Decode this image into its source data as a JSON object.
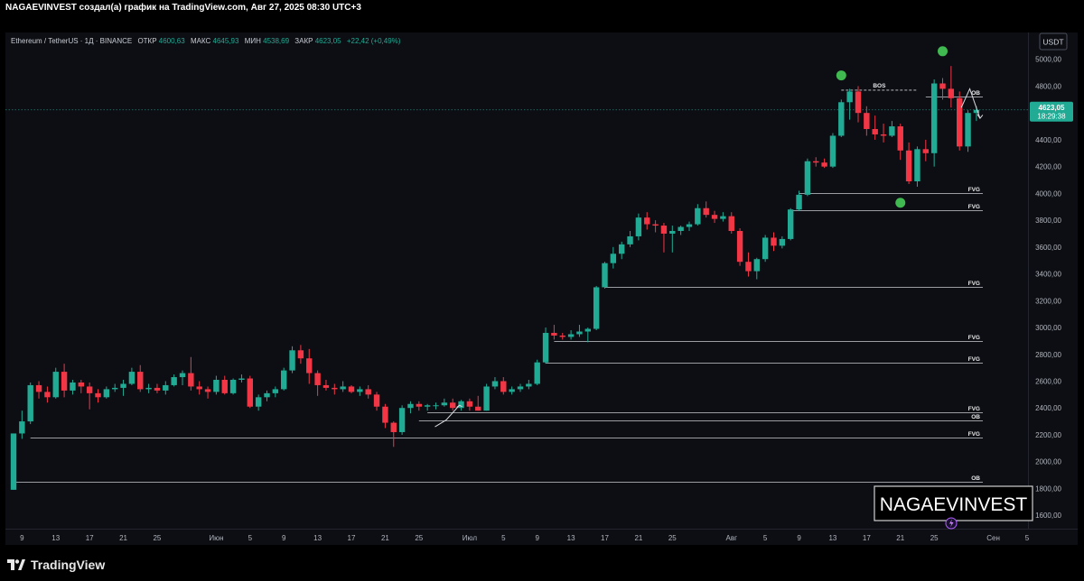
{
  "header": {
    "caption": "NAGAEVINVEST создал(а) график на TradingView.com, Авг 27, 2025 08:30 UTC+3"
  },
  "legend": {
    "symbol": "Ethereum / TetherUS · 1Д · BINANCE",
    "open_label": "ОТКР",
    "open_value": "4600,63",
    "high_label": "МАКС",
    "high_value": "4645,93",
    "low_label": "МИН",
    "low_value": "4538,69",
    "close_label": "ЗАКР",
    "close_value": "4623,05",
    "change": "+22,42 (+0,49%)"
  },
  "currency_button": "USDT",
  "price_badge": {
    "price": "4623,05",
    "countdown": "18:29:38"
  },
  "watermark": "NAGAEVINVEST",
  "brand": "TradingView",
  "colors": {
    "up": "#22ab94",
    "down": "#f23645",
    "background": "#0c0e14",
    "level_line": "#c9ccd3",
    "marker": "#3fb950"
  },
  "chart_data": {
    "type": "candlestick",
    "title": "",
    "ylabel": "",
    "xlabel": "",
    "ylim": [
      1500,
      5200
    ],
    "y_ticks": [
      "1600,00",
      "1800,00",
      "2000,00",
      "2200,00",
      "2400,00",
      "2600,00",
      "2800,00",
      "3000,00",
      "3200,00",
      "3400,00",
      "3600,00",
      "3800,00",
      "4000,00",
      "4200,00",
      "4400,00",
      "4600,00",
      "4800,00",
      "5000,00"
    ],
    "x_tick_labels": [
      {
        "label": "9",
        "bar": 1
      },
      {
        "label": "13",
        "bar": 5
      },
      {
        "label": "17",
        "bar": 9
      },
      {
        "label": "21",
        "bar": 13
      },
      {
        "label": "25",
        "bar": 17
      },
      {
        "label": "Июн",
        "bar": 24
      },
      {
        "label": "5",
        "bar": 28
      },
      {
        "label": "9",
        "bar": 32
      },
      {
        "label": "13",
        "bar": 36
      },
      {
        "label": "17",
        "bar": 40
      },
      {
        "label": "21",
        "bar": 44
      },
      {
        "label": "25",
        "bar": 48
      },
      {
        "label": "Июл",
        "bar": 54
      },
      {
        "label": "5",
        "bar": 58
      },
      {
        "label": "9",
        "bar": 62
      },
      {
        "label": "13",
        "bar": 66
      },
      {
        "label": "17",
        "bar": 70
      },
      {
        "label": "21",
        "bar": 74
      },
      {
        "label": "25",
        "bar": 78
      },
      {
        "label": "Авг",
        "bar": 85
      },
      {
        "label": "5",
        "bar": 89
      },
      {
        "label": "9",
        "bar": 93
      },
      {
        "label": "13",
        "bar": 97
      },
      {
        "label": "17",
        "bar": 101
      },
      {
        "label": "21",
        "bar": 105
      },
      {
        "label": "25",
        "bar": 109
      },
      {
        "label": "Сен",
        "bar": 116
      },
      {
        "label": "5",
        "bar": 120
      }
    ],
    "last_price": 4623.05,
    "candles": [
      [
        1790,
        2210,
        1790,
        2210
      ],
      [
        2210,
        2380,
        2170,
        2300
      ],
      [
        2300,
        2590,
        2280,
        2570
      ],
      [
        2570,
        2600,
        2470,
        2520
      ],
      [
        2520,
        2560,
        2440,
        2480
      ],
      [
        2480,
        2700,
        2470,
        2670
      ],
      [
        2670,
        2730,
        2480,
        2530
      ],
      [
        2530,
        2610,
        2500,
        2590
      ],
      [
        2590,
        2610,
        2510,
        2560
      ],
      [
        2560,
        2590,
        2390,
        2510
      ],
      [
        2510,
        2540,
        2440,
        2480
      ],
      [
        2480,
        2560,
        2470,
        2540
      ],
      [
        2540,
        2580,
        2520,
        2550
      ],
      [
        2550,
        2610,
        2490,
        2580
      ],
      [
        2580,
        2700,
        2570,
        2670
      ],
      [
        2670,
        2720,
        2520,
        2540
      ],
      [
        2540,
        2580,
        2510,
        2550
      ],
      [
        2550,
        2580,
        2510,
        2530
      ],
      [
        2530,
        2600,
        2500,
        2570
      ],
      [
        2570,
        2650,
        2560,
        2630
      ],
      [
        2630,
        2680,
        2570,
        2660
      ],
      [
        2660,
        2780,
        2530,
        2560
      ],
      [
        2560,
        2600,
        2500,
        2540
      ],
      [
        2540,
        2560,
        2470,
        2520
      ],
      [
        2520,
        2640,
        2500,
        2610
      ],
      [
        2610,
        2640,
        2500,
        2510
      ],
      [
        2510,
        2620,
        2500,
        2610
      ],
      [
        2610,
        2650,
        2590,
        2620
      ],
      [
        2620,
        2640,
        2400,
        2410
      ],
      [
        2410,
        2500,
        2380,
        2480
      ],
      [
        2480,
        2530,
        2450,
        2510
      ],
      [
        2510,
        2560,
        2480,
        2540
      ],
      [
        2540,
        2700,
        2530,
        2680
      ],
      [
        2680,
        2860,
        2660,
        2830
      ],
      [
        2830,
        2870,
        2730,
        2770
      ],
      [
        2770,
        2840,
        2580,
        2660
      ],
      [
        2660,
        2680,
        2490,
        2570
      ],
      [
        2570,
        2610,
        2530,
        2550
      ],
      [
        2550,
        2580,
        2500,
        2540
      ],
      [
        2540,
        2600,
        2520,
        2560
      ],
      [
        2560,
        2570,
        2510,
        2520
      ],
      [
        2520,
        2560,
        2490,
        2540
      ],
      [
        2540,
        2570,
        2470,
        2500
      ],
      [
        2500,
        2520,
        2380,
        2410
      ],
      [
        2410,
        2430,
        2250,
        2290
      ],
      [
        2290,
        2300,
        2110,
        2220
      ],
      [
        2220,
        2420,
        2200,
        2400
      ],
      [
        2400,
        2450,
        2360,
        2430
      ],
      [
        2430,
        2450,
        2380,
        2410
      ],
      [
        2410,
        2430,
        2380,
        2420
      ],
      [
        2420,
        2440,
        2390,
        2420
      ],
      [
        2420,
        2470,
        2410,
        2440
      ],
      [
        2440,
        2470,
        2380,
        2400
      ],
      [
        2400,
        2460,
        2380,
        2450
      ],
      [
        2450,
        2470,
        2380,
        2410
      ],
      [
        2410,
        2490,
        2380,
        2380
      ],
      [
        2380,
        2580,
        2380,
        2560
      ],
      [
        2560,
        2630,
        2540,
        2600
      ],
      [
        2600,
        2630,
        2500,
        2520
      ],
      [
        2520,
        2560,
        2500,
        2540
      ],
      [
        2540,
        2580,
        2520,
        2560
      ],
      [
        2560,
        2610,
        2540,
        2580
      ],
      [
        2580,
        2760,
        2570,
        2740
      ],
      [
        2740,
        3000,
        2730,
        2960
      ],
      [
        2960,
        3020,
        2910,
        2940
      ],
      [
        2940,
        2960,
        2910,
        2930
      ],
      [
        2930,
        2980,
        2910,
        2950
      ],
      [
        2950,
        3020,
        2930,
        2970
      ],
      [
        2970,
        3000,
        2890,
        2990
      ],
      [
        2990,
        3310,
        2980,
        3300
      ],
      [
        3300,
        3490,
        3290,
        3480
      ],
      [
        3480,
        3600,
        3440,
        3550
      ],
      [
        3550,
        3640,
        3510,
        3620
      ],
      [
        3620,
        3720,
        3600,
        3680
      ],
      [
        3680,
        3850,
        3650,
        3820
      ],
      [
        3820,
        3860,
        3730,
        3770
      ],
      [
        3770,
        3800,
        3710,
        3760
      ],
      [
        3760,
        3780,
        3560,
        3700
      ],
      [
        3700,
        3760,
        3560,
        3720
      ],
      [
        3720,
        3760,
        3690,
        3750
      ],
      [
        3750,
        3790,
        3720,
        3770
      ],
      [
        3770,
        3920,
        3760,
        3890
      ],
      [
        3890,
        3940,
        3820,
        3840
      ],
      [
        3840,
        3870,
        3780,
        3810
      ],
      [
        3810,
        3860,
        3790,
        3830
      ],
      [
        3830,
        3860,
        3700,
        3720
      ],
      [
        3720,
        3740,
        3460,
        3490
      ],
      [
        3490,
        3560,
        3380,
        3420
      ],
      [
        3420,
        3520,
        3360,
        3510
      ],
      [
        3510,
        3690,
        3490,
        3670
      ],
      [
        3670,
        3710,
        3570,
        3610
      ],
      [
        3610,
        3680,
        3590,
        3660
      ],
      [
        3660,
        3890,
        3650,
        3880
      ],
      [
        3880,
        4020,
        3870,
        3990
      ],
      [
        3990,
        4260,
        3980,
        4240
      ],
      [
        4240,
        4270,
        4200,
        4230
      ],
      [
        4230,
        4260,
        4190,
        4200
      ],
      [
        4200,
        4450,
        4190,
        4430
      ],
      [
        4430,
        4700,
        4420,
        4680
      ],
      [
        4680,
        4780,
        4550,
        4760
      ],
      [
        4760,
        4800,
        4530,
        4600
      ],
      [
        4600,
        4650,
        4430,
        4480
      ],
      [
        4480,
        4580,
        4400,
        4440
      ],
      [
        4440,
        4520,
        4380,
        4430
      ],
      [
        4430,
        4540,
        4420,
        4500
      ],
      [
        4500,
        4520,
        4250,
        4320
      ],
      [
        4320,
        4380,
        4070,
        4090
      ],
      [
        4090,
        4350,
        4050,
        4330
      ],
      [
        4330,
        4400,
        4240,
        4300
      ],
      [
        4300,
        4850,
        4200,
        4820
      ],
      [
        4820,
        4860,
        4700,
        4780
      ],
      [
        4780,
        4950,
        4640,
        4710
      ],
      [
        4710,
        4760,
        4320,
        4350
      ],
      [
        4350,
        4620,
        4310,
        4600
      ],
      [
        4600,
        4650,
        4540,
        4623
      ]
    ],
    "levels": [
      {
        "label": "OB",
        "price": 4720,
        "from_bar": 108
      },
      {
        "label": "FVG",
        "price": 4000,
        "from_bar": 93
      },
      {
        "label": "FVG",
        "price": 3875,
        "from_bar": 92
      },
      {
        "label": "FVG",
        "price": 3300,
        "from_bar": 70
      },
      {
        "label": "FVG",
        "price": 2900,
        "from_bar": 64
      },
      {
        "label": "FVG",
        "price": 2740,
        "from_bar": 63
      },
      {
        "label": "FVG",
        "price": 2370,
        "from_bar": 49
      },
      {
        "label": "OB",
        "price": 2310,
        "from_bar": 48
      },
      {
        "label": "FVG",
        "price": 2180,
        "from_bar": 2
      },
      {
        "label": "OB",
        "price": 1850,
        "from_bar": 0
      }
    ],
    "bos": {
      "label": "BOS",
      "price": 4770,
      "from_bar": 98,
      "to_bar": 107
    },
    "markers": [
      {
        "bar": 98,
        "price": 4880
      },
      {
        "bar": 110,
        "price": 5060
      },
      {
        "bar": 105,
        "price": 3930
      }
    ]
  }
}
